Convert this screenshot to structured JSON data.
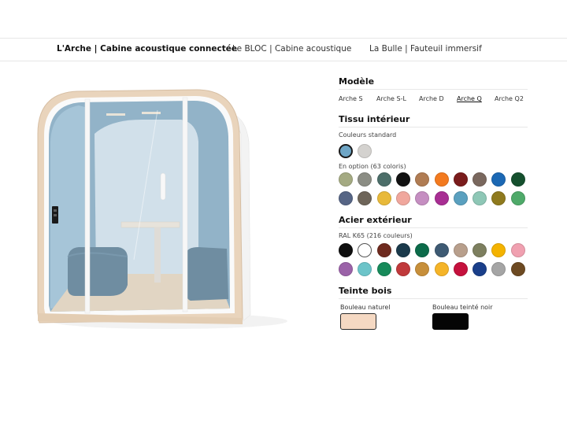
{
  "nav": {
    "tabs": [
      {
        "label": "L'Arche | Cabine acoustique connectée",
        "active": true
      },
      {
        "label": "Le BLOC | Cabine acoustique",
        "active": false
      },
      {
        "label": "La Bulle | Fauteuil immersif",
        "active": false
      }
    ]
  },
  "configurator": {
    "model": {
      "title": "Modèle",
      "options": [
        "Arche S",
        "Arche S-L",
        "Arche D",
        "Arche Q",
        "Arche Q2"
      ],
      "selected": "Arche Q"
    },
    "fabric": {
      "title": "Tissu intérieur",
      "standard_label": "Couleurs standard",
      "standard_colors": [
        "#6fa6c6",
        "#d4d2cf"
      ],
      "selected": "#6fa6c6",
      "option_label": "En option (63 coloris)",
      "option_colors": [
        [
          "#a4aa82",
          "#8b8d84",
          "#4c6e69",
          "#121212",
          "#b07c53",
          "#f37a1f",
          "#7a1c1c",
          "#7a685e",
          "#1b68b4",
          "#15502e"
        ],
        [
          "#566585",
          "#6e6559",
          "#e8b93a",
          "#f0a79d",
          "#c58ec1",
          "#a82e93",
          "#5aa0bf",
          "#8ec7b6",
          "#8f7a1e",
          "#4faa6a"
        ]
      ]
    },
    "steel": {
      "title": "Acier extérieur",
      "label": "RAL K65 (216 couleurs)",
      "colors": [
        [
          "#0f0f0f",
          "#ffffff",
          "#6e2a1e",
          "#1b3a4b",
          "#0c6b4a",
          "#3e5a73",
          "#b89f8c",
          "#7d7f5f",
          "#f4b300",
          "#f0a0b0"
        ],
        [
          "#9b62a8",
          "#6cc4c9",
          "#178a5a",
          "#c0393b",
          "#c78f3a",
          "#f5b428",
          "#c5113d",
          "#1a3f8a",
          "#a5a5a5",
          "#6d4a22"
        ]
      ]
    },
    "wood": {
      "title": "Teinte bois",
      "options": [
        {
          "label": "Bouleau naturel",
          "color": "#f5d9c3",
          "selected": true
        },
        {
          "label": "Bouleau teinté noir",
          "color": "#050505",
          "selected": false
        }
      ]
    }
  },
  "preview": {
    "colors": {
      "wood": "#e9d4bc",
      "fabric": "#6b92aa",
      "seat": "#4f7288",
      "glass": "#cfe0ea"
    }
  }
}
